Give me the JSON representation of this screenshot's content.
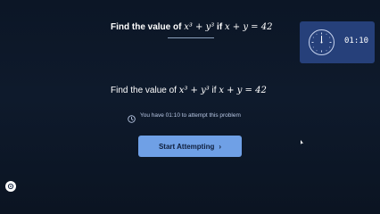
{
  "header": {
    "title_prefix": "Find the value of ",
    "title_expr": "x³ + y³",
    "title_mid": " if ",
    "title_cond": "x + y = 42"
  },
  "timer": {
    "time": "01:10",
    "icon": "clock-icon"
  },
  "question": {
    "prefix": "Find the value of ",
    "expr": "x³ + y³",
    "mid": " if ",
    "cond": "x + y = 42"
  },
  "hint": {
    "icon": "clock-icon",
    "text": "You have 01:10 to attempt this problem"
  },
  "start_button": {
    "label": "Start Attempting",
    "icon": "chevron-right-icon"
  },
  "corner": {
    "icon": "settings-icon"
  },
  "colors": {
    "background": "#0e1a2c",
    "timer_bg": "#26407a",
    "button_bg": "#6fa0e6",
    "hint_text": "#b9c7e4"
  }
}
